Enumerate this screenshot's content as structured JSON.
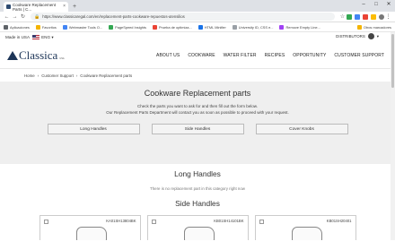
{
  "browser": {
    "tab_title": "Cookware Replacement Parts | C...",
    "tab_close": "×",
    "new_tab": "+",
    "url": "https://www.classicaregal.com/en/replacement-parts-cookware-repuestos-utensilios",
    "bookmarks": [
      "Aplicaciones",
      "Favoritos",
      "Webmaster Tools O...",
      "PageSpeed Insights",
      "Prueba de optimiza...",
      "HTML Minifier",
      "University ID, CSS e...",
      "Remove Empty Line..."
    ],
    "other_bookmarks": "Otros marcadores"
  },
  "topbar": {
    "made_in": "Made in USA",
    "language": "ENG",
    "distributors": "DISTRIBUTORS"
  },
  "logo": {
    "name": "Classica",
    "sub": "USA"
  },
  "nav": [
    "ABOUT US",
    "COOKWARE",
    "WATER FILTER",
    "RECIPES",
    "OPPORTUNITY",
    "CUSTOMER SUPPORT"
  ],
  "breadcrumb": [
    "Home",
    "Customer Support",
    "Cookware Replacement parts"
  ],
  "hero": {
    "title": "Cookware Replacement parts",
    "line1": "Check the parts you want to ask for and then fill out the form below.",
    "line2": "Our Replacement Parts Department will contact you as soon as possible to proceed with your request.",
    "buttons": [
      "Long Handles",
      "Side Handles",
      "Cover Knobs"
    ]
  },
  "long_handles": {
    "title": "Long Handles",
    "note": "There is no replacement part in this category right now"
  },
  "side_handles": {
    "title": "Side Handles",
    "products": [
      "KA01SH13804BK",
      "KB01SH14101BK",
      "KB01SH20401"
    ]
  }
}
